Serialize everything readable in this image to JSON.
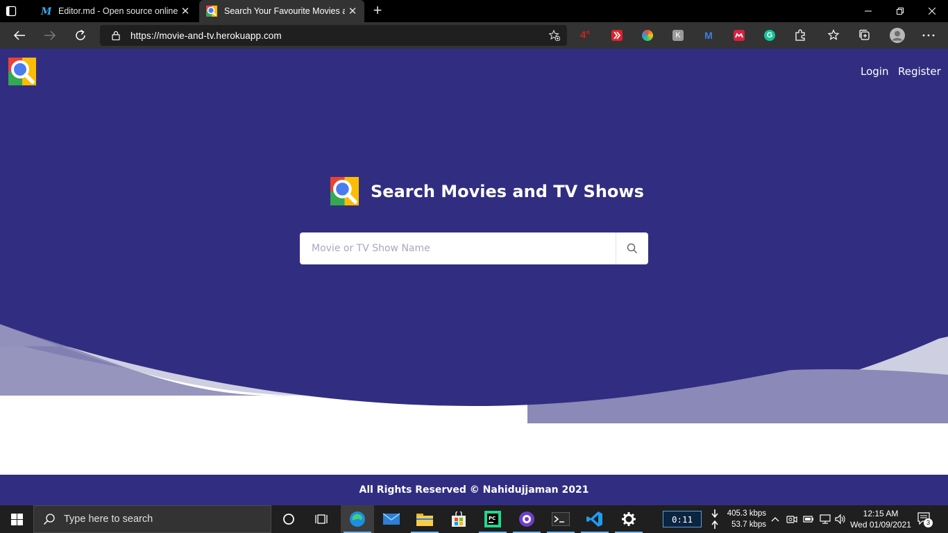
{
  "browser": {
    "tabs": [
      {
        "title": "Editor.md - Open source online M",
        "active": false
      },
      {
        "title": "Search Your Favourite Movies an",
        "active": true
      }
    ],
    "address": {
      "url": "https://movie-and-tv.herokuapp.com"
    },
    "extensions": [
      "weather-4-degree-icon",
      "red-play-icon",
      "colorful-wheel-icon",
      "k-icon",
      "m-icon",
      "mendeley-icon",
      "grammarly-icon",
      "puzzle-icon"
    ],
    "weather_text": "4°"
  },
  "site": {
    "nav": {
      "login": "Login",
      "register": "Register"
    },
    "title": "Search Movies and TV Shows",
    "search": {
      "placeholder": "Movie or TV Show Name"
    },
    "footer": "All Rights Reserved © Nahidujjaman 2021",
    "colors": {
      "primary": "#312e81",
      "wave_light": "#8b89b7",
      "wave_lighter": "#cfcfe2"
    }
  },
  "taskbar": {
    "search_placeholder": "Type here to search",
    "timer": "0:11",
    "net_down": "405.3 kbps",
    "net_up": "53.7 kbps",
    "time": "12:15 AM",
    "date": "Wed 01/09/2021",
    "notifications": "3",
    "apps": [
      "cortana-icon",
      "task-view-icon",
      "edge-icon",
      "mail-icon",
      "file-explorer-icon",
      "store-icon",
      "pycharm-icon",
      "github-desktop-icon",
      "terminal-icon",
      "vscode-icon",
      "settings-icon"
    ]
  }
}
